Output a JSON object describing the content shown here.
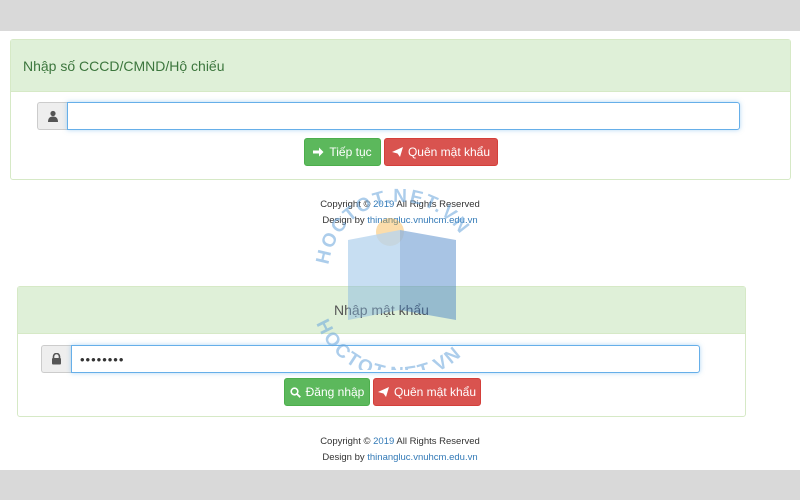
{
  "step1": {
    "heading": "Nhập số CCCD/CMND/Hộ chiếu",
    "id_value": "",
    "continue_label": "Tiếp tục",
    "forgot_label": "Quên mật khẩu"
  },
  "footer1": {
    "copyright_prefix": "Copyright © ",
    "year": "2019",
    "copyright_suffix": " All Rights Reserved",
    "design_prefix": "Design by ",
    "design_link": "thinangluc.vnuhcm.edu.vn"
  },
  "step2": {
    "heading": "Nhập mật khẩu",
    "password_value": "••••••••",
    "login_label": "Đăng nhập",
    "forgot_label": "Quên mật khẩu"
  },
  "footer2": {
    "copyright_prefix": "Copyright © ",
    "year": "2019",
    "copyright_suffix": " All Rights Reserved",
    "design_prefix": "Design by ",
    "design_link": "thinangluc.vnuhcm.edu.vn"
  },
  "watermark": {
    "text_top": "HOCTOT.NET.VN",
    "text_bottom": "HOCTOT.NET.VN"
  },
  "colors": {
    "success": "#5cb85c",
    "danger": "#d9534f",
    "panel_head": "#dff0d8",
    "link": "#337ab7"
  }
}
